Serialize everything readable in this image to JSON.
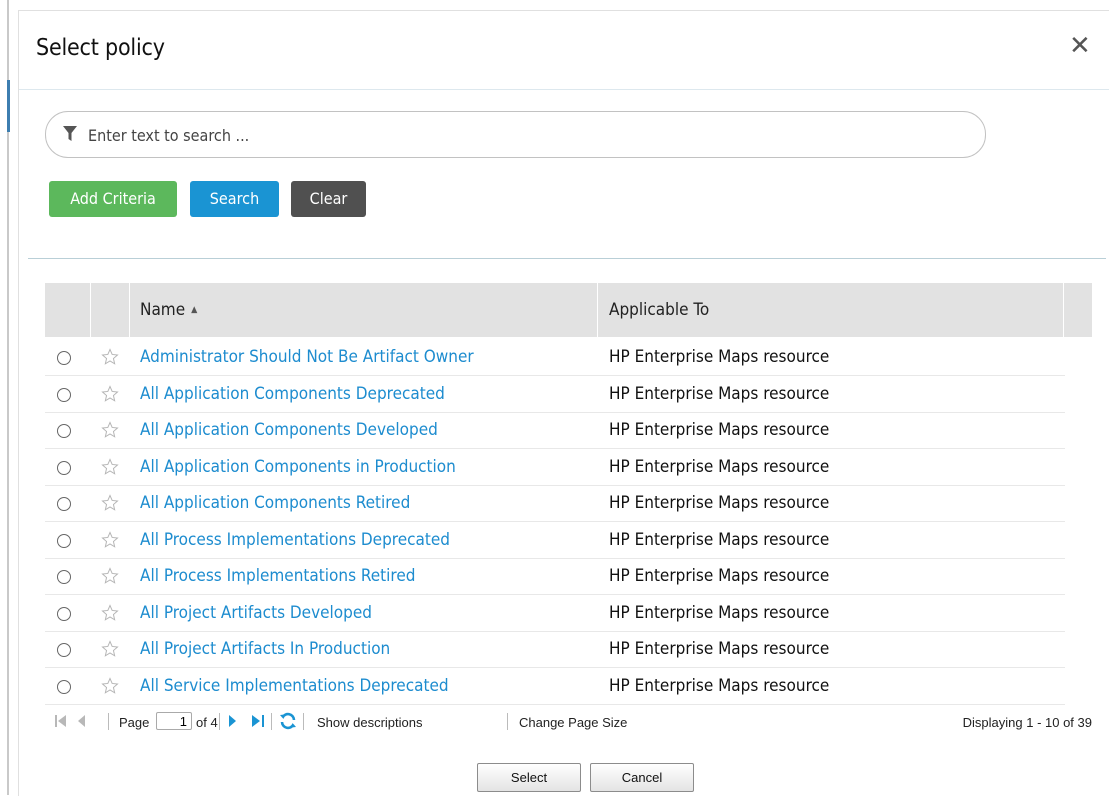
{
  "dialog": {
    "title": "Select policy",
    "close_icon": "close-icon"
  },
  "search": {
    "placeholder": "Enter text to search ...",
    "value": "",
    "icon": "filter-icon"
  },
  "buttons": {
    "add_criteria": "Add Criteria",
    "search": "Search",
    "clear": "Clear"
  },
  "colors": {
    "add_criteria": "#5cb85c",
    "search": "#1a94d3",
    "clear": "#505050",
    "link": "#1d8ccf",
    "pager_icon_active": "#1a94d3"
  },
  "grid": {
    "columns": [
      "Name",
      "Applicable To"
    ],
    "sort_column": "Name",
    "sort_direction": "ascending",
    "rows": [
      {
        "name": "Administrator Should Not Be Artifact Owner",
        "applicable_to": "HP Enterprise Maps resource"
      },
      {
        "name": "All Application Components Deprecated",
        "applicable_to": "HP Enterprise Maps resource"
      },
      {
        "name": "All Application Components Developed",
        "applicable_to": "HP Enterprise Maps resource"
      },
      {
        "name": "All Application Components in Production",
        "applicable_to": "HP Enterprise Maps resource"
      },
      {
        "name": "All Application Components Retired",
        "applicable_to": "HP Enterprise Maps resource"
      },
      {
        "name": "All Process Implementations Deprecated",
        "applicable_to": "HP Enterprise Maps resource"
      },
      {
        "name": "All Process Implementations Retired",
        "applicable_to": "HP Enterprise Maps resource"
      },
      {
        "name": "All Project Artifacts Developed",
        "applicable_to": "HP Enterprise Maps resource"
      },
      {
        "name": "All Project Artifacts In Production",
        "applicable_to": "HP Enterprise Maps resource"
      },
      {
        "name": "All Service Implementations Deprecated",
        "applicable_to": "HP Enterprise Maps resource"
      }
    ]
  },
  "pager": {
    "page_label": "Page",
    "current_page": "1",
    "of_label": "of 4",
    "show_descriptions": "Show descriptions",
    "change_page_size": "Change Page Size",
    "displaying": "Displaying 1 - 10 of 39"
  },
  "footer": {
    "select": "Select",
    "cancel": "Cancel"
  }
}
